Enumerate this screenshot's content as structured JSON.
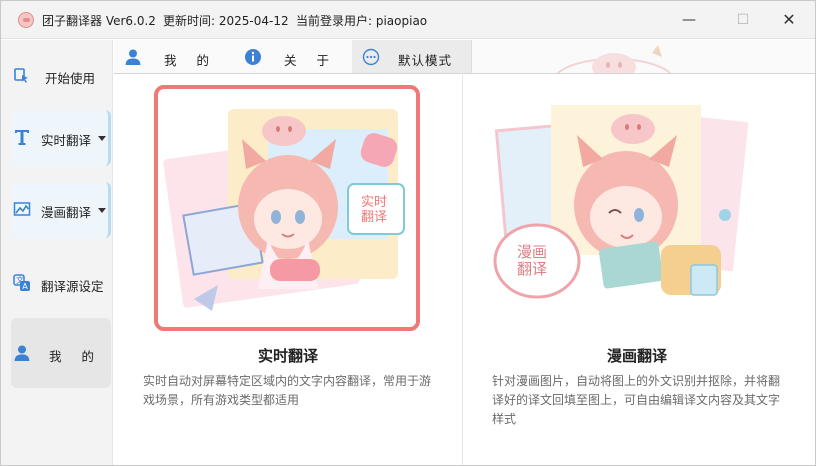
{
  "window": {
    "app_name": "团子翻译器 Ver6.0.2",
    "update_time": "更新时间: 2025-04-12",
    "current_user": "当前登录用户: piaopiao",
    "controls": {
      "minimize": "—",
      "maximize": "☐",
      "close": "✕"
    }
  },
  "sidebar": {
    "items": [
      {
        "label": "开始使用",
        "icon": "start-icon",
        "expandable": false
      },
      {
        "label": "实时翻译",
        "icon": "text-t-icon",
        "expandable": true
      },
      {
        "label": "漫画翻译",
        "icon": "image-chart-icon",
        "expandable": true
      },
      {
        "label": "翻译源设定",
        "icon": "translate-source-icon",
        "expandable": false
      },
      {
        "label": "我的",
        "icon": "user-icon",
        "expandable": false,
        "selected": true
      }
    ]
  },
  "tabs": [
    {
      "label": "我的",
      "icon": "user-icon"
    },
    {
      "label": "关于",
      "icon": "info-icon"
    },
    {
      "label": "默认模式",
      "icon": "dots-circle-icon",
      "active": true
    }
  ],
  "cards": [
    {
      "title": "实时翻译",
      "description": "实时自动对屏幕特定区域内的文字内容翻译，常用于游戏场景，所有游戏类型都适用",
      "badge_text": "实时翻译",
      "highlighted": true
    },
    {
      "title": "漫画翻译",
      "description": "针对漫画图片，自动将图上的外文识别并抠除，并将翻译好的译文回填至图上，可自由编辑译文内容及其文字样式",
      "badge_text": "漫画翻译",
      "highlighted": false
    }
  ],
  "colors": {
    "accent": "#f07875",
    "sidebar_bg": "#f3f3f3",
    "selected_bg": "#e6e6e6",
    "icon_blue": "#3b82d6",
    "desc_gray": "#6b6b6b"
  }
}
